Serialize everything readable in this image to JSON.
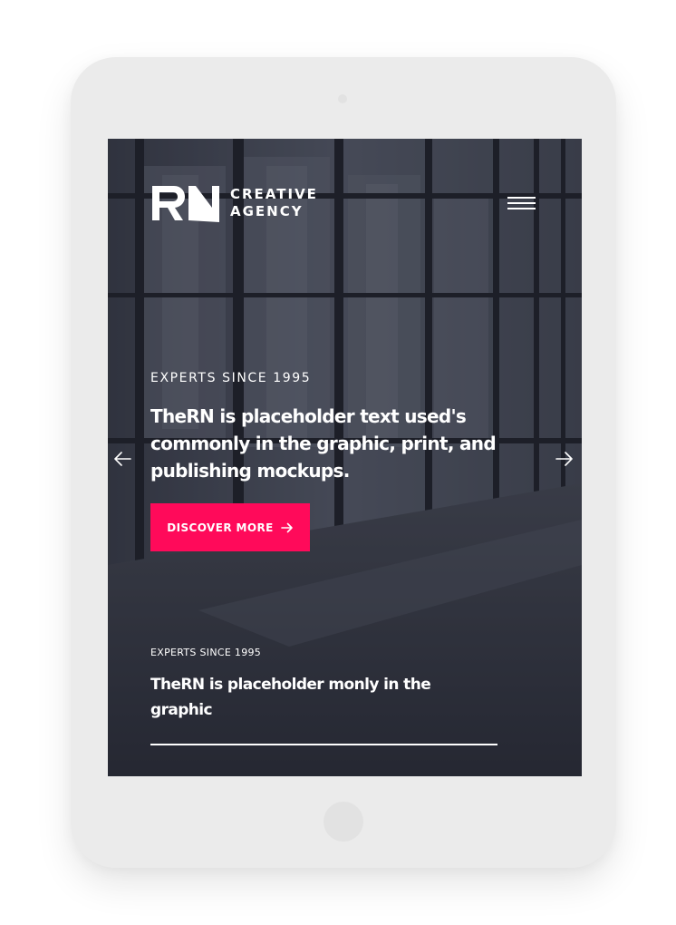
{
  "brand": {
    "line1": "CREATIVE",
    "line2": "AGENCY",
    "logo_icon": "rn-logo-icon"
  },
  "header": {
    "menu_icon": "hamburger-menu-icon"
  },
  "hero": {
    "eyebrow": "EXPERTS SINCE 1995",
    "headline": "TheRN is placeholder text used's commonly in the graphic, print, and publishing mockups.",
    "cta_label": "DISCOVER MORE",
    "cta_icon": "arrow-right-icon",
    "prev_icon": "arrow-left-icon",
    "next_icon": "arrow-right-icon"
  },
  "next_slide": {
    "eyebrow": "EXPERTS SINCE 1995",
    "headline": "TheRN is placeholder monly in the graphic",
    "progress": 1.0
  },
  "colors": {
    "accent": "#ff0a5a",
    "frame": "#ebebeb",
    "overlay": "#1a1c28",
    "text": "#ffffff"
  }
}
